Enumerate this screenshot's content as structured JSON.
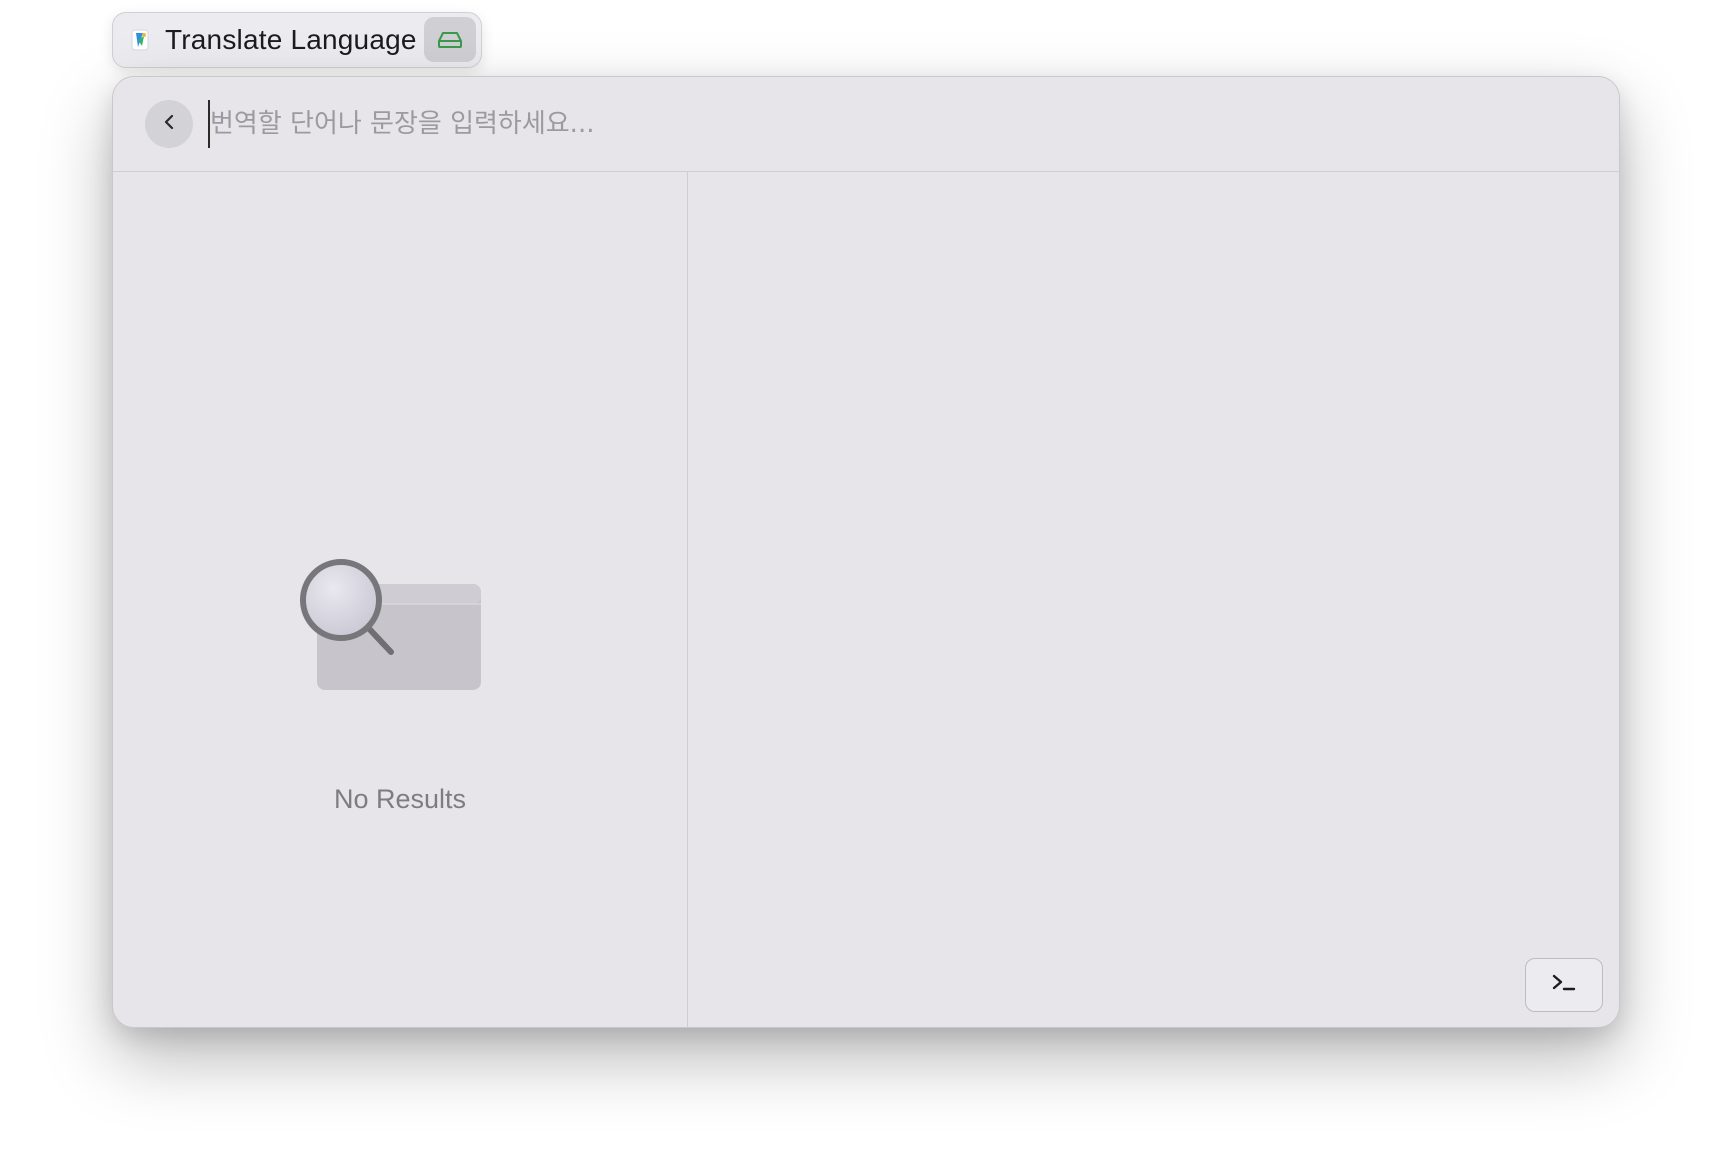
{
  "titlebar": {
    "title": "Translate Language",
    "app_icon": "translate-app-icon",
    "action_icon": "storage-drive-icon",
    "action_icon_color": "#3a9a4a"
  },
  "search": {
    "placeholder": "번역할 단어나 문장을 입력하세요...",
    "value": "",
    "back_icon": "chevron-left-icon"
  },
  "results": {
    "empty_label": "No Results",
    "empty_icon": "magnifier-empty-icon"
  },
  "footer": {
    "terminal_icon": "terminal-prompt-icon"
  },
  "colors": {
    "window_bg": "#e7e5ea",
    "border": "#cfcdd2",
    "placeholder": "#9b9aa0",
    "muted_text": "#7d7c82"
  }
}
